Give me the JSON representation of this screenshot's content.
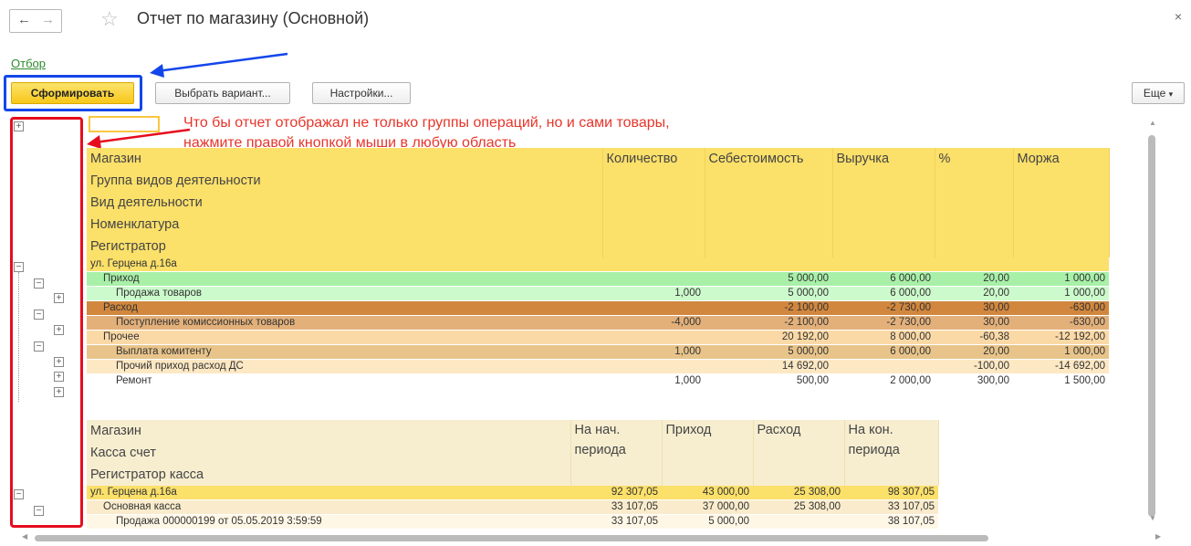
{
  "header": {
    "title": "Отчет по магазину (Основной)"
  },
  "filter_link": "Отбор",
  "toolbar": {
    "generate": "Сформировать",
    "choose_variant": "Выбрать вариант...",
    "settings": "Настройки...",
    "more": "Еще"
  },
  "annotation": {
    "line1": "Что бы отчет отображал не только группы операций, но и сами товары,",
    "line2": "нажмите правой кнопкой мыши в любую область"
  },
  "colors": {
    "blue_box": "#1346ea",
    "red_box": "#e60c1d",
    "arrow_blue": "#1346ea",
    "arrow_red": "#e60c1d"
  },
  "table1": {
    "group_headers": [
      "Магазин",
      "Группа видов деятельности",
      "Вид деятельности",
      "Номенклатура",
      "Регистратор"
    ],
    "columns": [
      "Количество",
      "Себестоимость",
      "Выручка",
      "%",
      "Моржа"
    ],
    "rows": [
      {
        "label": "ул. Герцена д.16а",
        "qty": "",
        "cost": "",
        "rev": "",
        "pct": "",
        "margin": "",
        "bg": "#fbe06a",
        "indent": 0
      },
      {
        "label": "Приход",
        "qty": "",
        "cost": "5 000,00",
        "rev": "6 000,00",
        "pct": "20,00",
        "margin": "1 000,00",
        "bg": "#a8f0a8",
        "indent": 1
      },
      {
        "label": "Продажа товаров",
        "qty": "1,000",
        "cost": "5 000,00",
        "rev": "6 000,00",
        "pct": "20,00",
        "margin": "1 000,00",
        "bg": "#ccfacc",
        "indent": 2
      },
      {
        "label": "Расход",
        "qty": "",
        "cost": "-2 100,00",
        "rev": "-2 730,00",
        "pct": "30,00",
        "margin": "-630,00",
        "bg": "#d1873e",
        "indent": 1
      },
      {
        "label": "Поступление комиссионных товаров",
        "qty": "-4,000",
        "cost": "-2 100,00",
        "rev": "-2 730,00",
        "pct": "30,00",
        "margin": "-630,00",
        "bg": "#e3b07a",
        "indent": 2
      },
      {
        "label": "Прочее",
        "qty": "",
        "cost": "20 192,00",
        "rev": "8 000,00",
        "pct": "-60,38",
        "margin": "-12 192,00",
        "bg": "#fbd9a6",
        "indent": 1
      },
      {
        "label": "Выплата комитенту",
        "qty": "1,000",
        "cost": "5 000,00",
        "rev": "6 000,00",
        "pct": "20,00",
        "margin": "1 000,00",
        "bg": "#e8c48a",
        "indent": 2
      },
      {
        "label": "Прочий приход расход ДС",
        "qty": "",
        "cost": "14 692,00",
        "rev": "",
        "pct": "-100,00",
        "margin": "-14 692,00",
        "bg": "#fde8c4",
        "indent": 2
      },
      {
        "label": "Ремонт",
        "qty": "1,000",
        "cost": "500,00",
        "rev": "2 000,00",
        "pct": "300,00",
        "margin": "1 500,00",
        "bg": "#ffffff",
        "indent": 2
      }
    ]
  },
  "table2": {
    "group_headers": [
      "Магазин",
      "Касса счет",
      "Регистратор касса"
    ],
    "columns": [
      "На нач. периода",
      "Приход",
      "Расход",
      "На кон. периода"
    ],
    "rows": [
      {
        "label": "ул. Герцена д.16а",
        "start": "92 307,05",
        "in": "43 000,00",
        "out": "25 308,00",
        "end": "98 307,05",
        "bg": "#fbe06a",
        "indent": 0
      },
      {
        "label": "Основная касса",
        "start": "33 107,05",
        "in": "37 000,00",
        "out": "25 308,00",
        "end": "33 107,05",
        "bg": "#f9ebcb",
        "indent": 1
      },
      {
        "label": "Продажа 000000199 от 05.05.2019 3:59:59",
        "start": "33 107,05",
        "in": "5 000,00",
        "out": "",
        "end": "38 107,05",
        "bg": "#fff7e6",
        "indent": 2
      }
    ]
  }
}
